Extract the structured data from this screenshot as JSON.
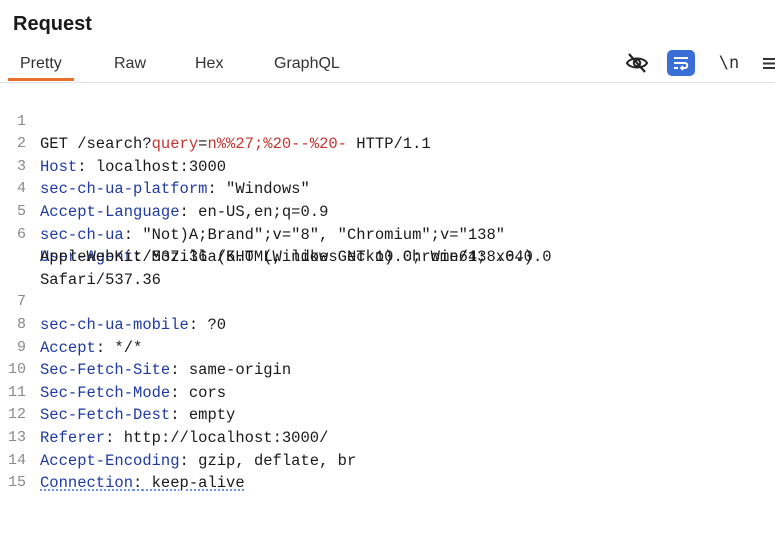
{
  "panel": {
    "title": "Request"
  },
  "tabs": [
    {
      "label": "Pretty",
      "active": true
    },
    {
      "label": "Raw",
      "active": false
    },
    {
      "label": "Hex",
      "active": false
    },
    {
      "label": "GraphQL",
      "active": false
    }
  ],
  "toolbar": {
    "hide_icon": "eye-slash-icon",
    "wrap_icon": "wrap-lines-icon",
    "newline_label": "\\n",
    "menu_icon": "hamburger-menu-icon"
  },
  "colors": {
    "accent_tab": "#e8702a",
    "header_key": "#1f3aa6",
    "query_value": "#c4352f",
    "wrap_button": "#3b6fd8"
  },
  "request": {
    "request_line": {
      "method_path": "GET /search?",
      "param_name": "query",
      "equals": "=",
      "param_value": "n%%27;%20--%20-",
      "protocol": " HTTP/1.1"
    },
    "headers": [
      {
        "num": "2",
        "key": "Host",
        "value": " localhost:3000"
      },
      {
        "num": "3",
        "key": "sec-ch-ua-platform",
        "value": " \"Windows\""
      },
      {
        "num": "4",
        "key": "Accept-Language",
        "value": " en-US,en;q=0.9"
      },
      {
        "num": "5",
        "key": "sec-ch-ua",
        "value": " \"Not)A;Brand\";v=\"8\", \"Chromium\";v=\"138\""
      },
      {
        "num": "6",
        "key": "User-Agent",
        "value": " Mozilla/5.0 (Windows NT 10.0; Win64; x64)"
      },
      {
        "num": "7",
        "key": "sec-ch-ua-mobile",
        "value": " ?0"
      },
      {
        "num": "8",
        "key": "Accept",
        "value": " */*"
      },
      {
        "num": "9",
        "key": "Sec-Fetch-Site",
        "value": " same-origin"
      },
      {
        "num": "10",
        "key": "Sec-Fetch-Mode",
        "value": " cors"
      },
      {
        "num": "11",
        "key": "Sec-Fetch-Dest",
        "value": " empty"
      },
      {
        "num": "12",
        "key": "Referer",
        "value": " http://localhost:3000/"
      },
      {
        "num": "13",
        "key": "Accept-Encoding",
        "value": " gzip, deflate, br"
      },
      {
        "num": "14",
        "key": "Connection",
        "value": " keep-alive"
      }
    ],
    "user_agent_cont_1": "AppleWebKit/537.36 (KHTML, like Gecko) Chrome/138.0.0.0",
    "user_agent_cont_2": "Safari/537.36",
    "line_1_num": "1",
    "line_15_num": "15",
    "colon": ":"
  }
}
